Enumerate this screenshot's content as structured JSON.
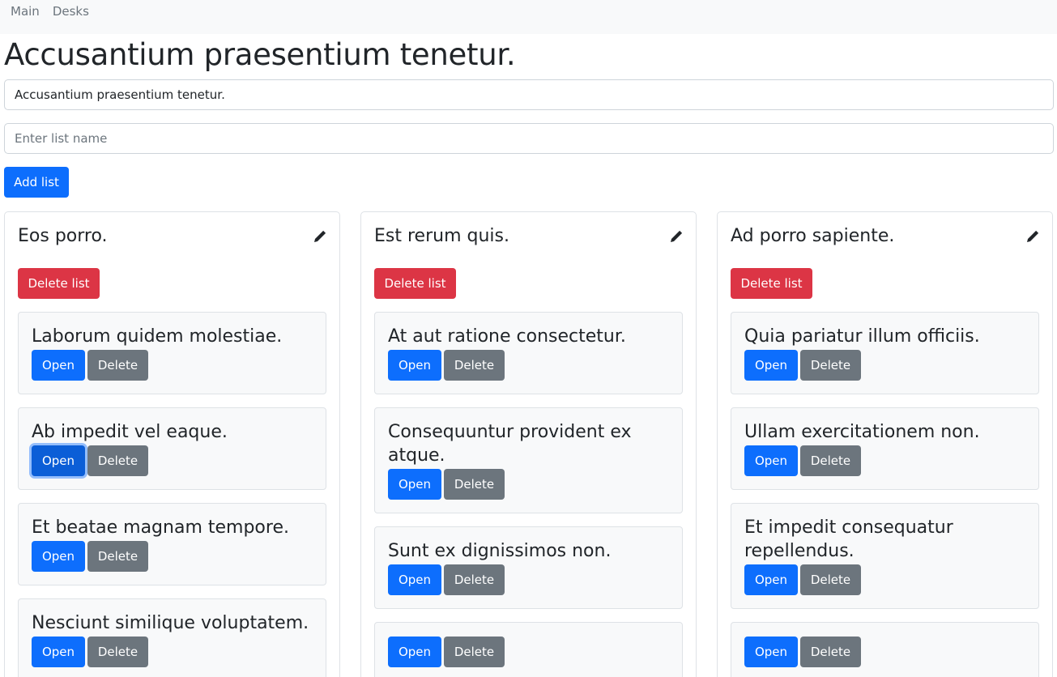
{
  "nav": {
    "items": [
      "Main",
      "Desks"
    ]
  },
  "page": {
    "title": "Accusantium praesentium tenetur.",
    "desk_name_value": "Accusantium praesentium tenetur.",
    "list_name_placeholder": "Enter list name",
    "add_list_label": "Add list"
  },
  "lists": [
    {
      "title": "Eos porro.",
      "delete_label": "Delete list",
      "cards": [
        {
          "title": "Laborum quidem molestiae.",
          "open_label": "Open",
          "delete_label": "Delete"
        },
        {
          "title": "Ab impedit vel eaque.",
          "open_label": "Open",
          "delete_label": "Delete"
        },
        {
          "title": "Et beatae magnam tempore.",
          "open_label": "Open",
          "delete_label": "Delete"
        },
        {
          "title": "Nesciunt similique voluptatem.",
          "open_label": "Open",
          "delete_label": "Delete"
        }
      ]
    },
    {
      "title": "Est rerum quis.",
      "delete_label": "Delete list",
      "cards": [
        {
          "title": "At aut ratione consectetur.",
          "open_label": "Open",
          "delete_label": "Delete"
        },
        {
          "title": "Consequuntur provident ex atque.",
          "open_label": "Open",
          "delete_label": "Delete"
        },
        {
          "title": "Sunt ex dignissimos non.",
          "open_label": "Open",
          "delete_label": "Delete"
        },
        {
          "title": "",
          "open_label": "Open",
          "delete_label": "Delete"
        }
      ]
    },
    {
      "title": "Ad porro sapiente.",
      "delete_label": "Delete list",
      "cards": [
        {
          "title": "Quia pariatur illum officiis.",
          "open_label": "Open",
          "delete_label": "Delete"
        },
        {
          "title": "Ullam exercitationem non.",
          "open_label": "Open",
          "delete_label": "Delete"
        },
        {
          "title": "Et impedit consequatur repellendus.",
          "open_label": "Open",
          "delete_label": "Delete"
        },
        {
          "title": "",
          "open_label": "Open",
          "delete_label": "Delete"
        }
      ]
    }
  ],
  "icons": {
    "edit": "pencil-icon"
  },
  "colors": {
    "primary": "#0d6efd",
    "danger": "#dc3545",
    "secondary": "#6c757d",
    "card_bg": "#f8f9fa",
    "navbar_bg": "#f8f9fa"
  }
}
